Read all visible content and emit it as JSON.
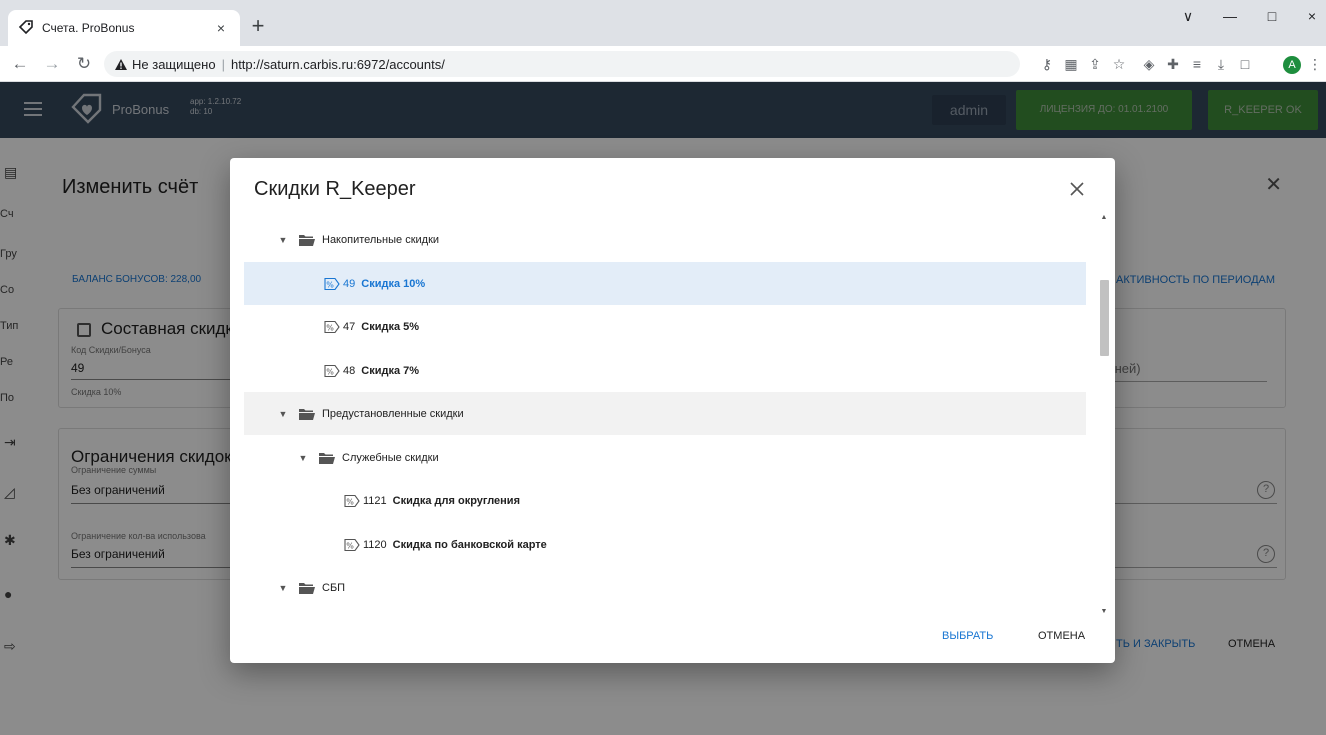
{
  "browser": {
    "tab_title": "Счета. ProBonus",
    "tab_close": "×",
    "new_tab": "+",
    "window_controls": [
      "∨",
      "—",
      "□",
      "×"
    ],
    "security_label": "Не защищено",
    "url": "http://saturn.carbis.ru:6972/accounts/",
    "profile_initial": "A"
  },
  "app": {
    "logo_text": "ProBonus",
    "version_app": "app: 1.2.10.72",
    "version_db": "db: 10",
    "user": "admin",
    "license": "ЛИЦЕНЗИЯ ДО: 01.01.2100",
    "rkeeper_status": "R_KEEPER OK",
    "side_labels": [
      "Сч",
      "Гру",
      "Со",
      "Тип",
      "Ре",
      "По"
    ]
  },
  "account_dialog": {
    "title": "Изменить счёт",
    "balance": "БАЛАНС БОНУСОВ: 228,00",
    "activity_tab": "АКТИВНОСТЬ ПО ПЕРИОДАМ",
    "composite_label": "Составная скидка",
    "code_label": "Код Скидки/Бонуса",
    "code_value": "49",
    "code_name": "Скидка 10%",
    "limits_title": "Ограничения скидок",
    "sum_limit_label": "Ограничение суммы",
    "sum_limit_value": "Без ограничений",
    "count_limit_label": "Ограничение кол-ва использова",
    "count_limit_value": "Без ограничений",
    "days_fragment": "дней)",
    "save_close": "ТЬ И ЗАКРЫТЬ",
    "cancel": "ОТМЕНА"
  },
  "modal": {
    "title": "Скидки R_Keeper",
    "select_label": "ВЫБРАТЬ",
    "cancel_label": "ОТМЕНА",
    "tree": [
      {
        "kind": "folder",
        "level": 0,
        "name": "Накопительные скидки"
      },
      {
        "kind": "discount",
        "level": 1,
        "code": "49",
        "name": "Скидка 10%",
        "selected": true
      },
      {
        "kind": "discount",
        "level": 1,
        "code": "47",
        "name": "Скидка 5%"
      },
      {
        "kind": "discount",
        "level": 1,
        "code": "48",
        "name": "Скидка 7%"
      },
      {
        "kind": "folder",
        "level": 0,
        "name": "Предустановленные скидки",
        "hover": true
      },
      {
        "kind": "folder",
        "level": 1,
        "name": "Служебные скидки"
      },
      {
        "kind": "discount",
        "level": 2,
        "code": "1121",
        "name": "Скидка для округления"
      },
      {
        "kind": "discount",
        "level": 2,
        "code": "1120",
        "name": "Скидка по банковской карте"
      },
      {
        "kind": "folder",
        "level": 0,
        "name": "СБП"
      }
    ]
  },
  "colors": {
    "accent": "#1976d2",
    "header_bg": "#36495e",
    "license_bg": "#3f8c3a",
    "selected_row": "#e3edf8"
  }
}
